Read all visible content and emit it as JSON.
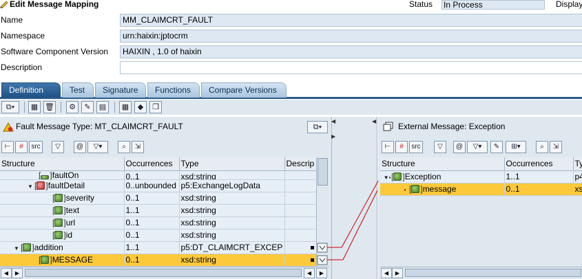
{
  "header": {
    "title": "Edit Message Mapping",
    "status_label": "Status",
    "status_value": "In Process",
    "display_label": "Display"
  },
  "form": {
    "name_label": "Name",
    "name_value": "MM_CLAIMCRT_FAULT",
    "namespace_label": "Namespace",
    "namespace_value": "urn:haixin:jptocrm",
    "swcv_label": "Software Component Version",
    "swcv_value": "HAIXIN , 1.0 of haixin",
    "description_label": "Description",
    "description_value": ""
  },
  "tabs": [
    {
      "label": "Definition",
      "active": true
    },
    {
      "label": "Test",
      "active": false
    },
    {
      "label": "Signature",
      "active": false
    },
    {
      "label": "Functions",
      "active": false
    },
    {
      "label": "Compare Versions",
      "active": false
    }
  ],
  "source_panel": {
    "title": "Fault Message Type: MT_CLAIMCRT_FAULT",
    "columns": [
      "Structure",
      "Occurrences",
      "Type",
      "Descrip"
    ],
    "rows": [
      {
        "structure": "faultOn",
        "occurrences": "0..1",
        "type": "xsd:string"
      },
      {
        "structure": "faultDetail",
        "occurrences": "0..unbounded",
        "type": "p5:ExchangeLogData"
      },
      {
        "structure": "severity",
        "occurrences": "0..1",
        "type": "xsd:string"
      },
      {
        "structure": "text",
        "occurrences": "1..1",
        "type": "xsd:string"
      },
      {
        "structure": "url",
        "occurrences": "0..1",
        "type": "xsd:string"
      },
      {
        "structure": "id",
        "occurrences": "0..1",
        "type": "xsd:string"
      },
      {
        "structure": "addition",
        "occurrences": "1..1",
        "type": "p5:DT_CLAIMCRT_EXCEP"
      },
      {
        "structure": "MESSAGE",
        "occurrences": "0..1",
        "type": "xsd:string"
      }
    ]
  },
  "target_panel": {
    "title": "External Message: Exception",
    "columns": [
      "Structure",
      "Occurrences",
      "Ty"
    ],
    "rows": [
      {
        "structure": "Exception",
        "occurrences": "1..1",
        "type": "p4"
      },
      {
        "structure": "message",
        "occurrences": "0..1",
        "type": "xs"
      }
    ]
  },
  "colors": {
    "selection": "#fcc93b",
    "tab_active": "#1f5184",
    "panel_bg": "#dfe7ef",
    "mapping_line": "#cc0000"
  }
}
